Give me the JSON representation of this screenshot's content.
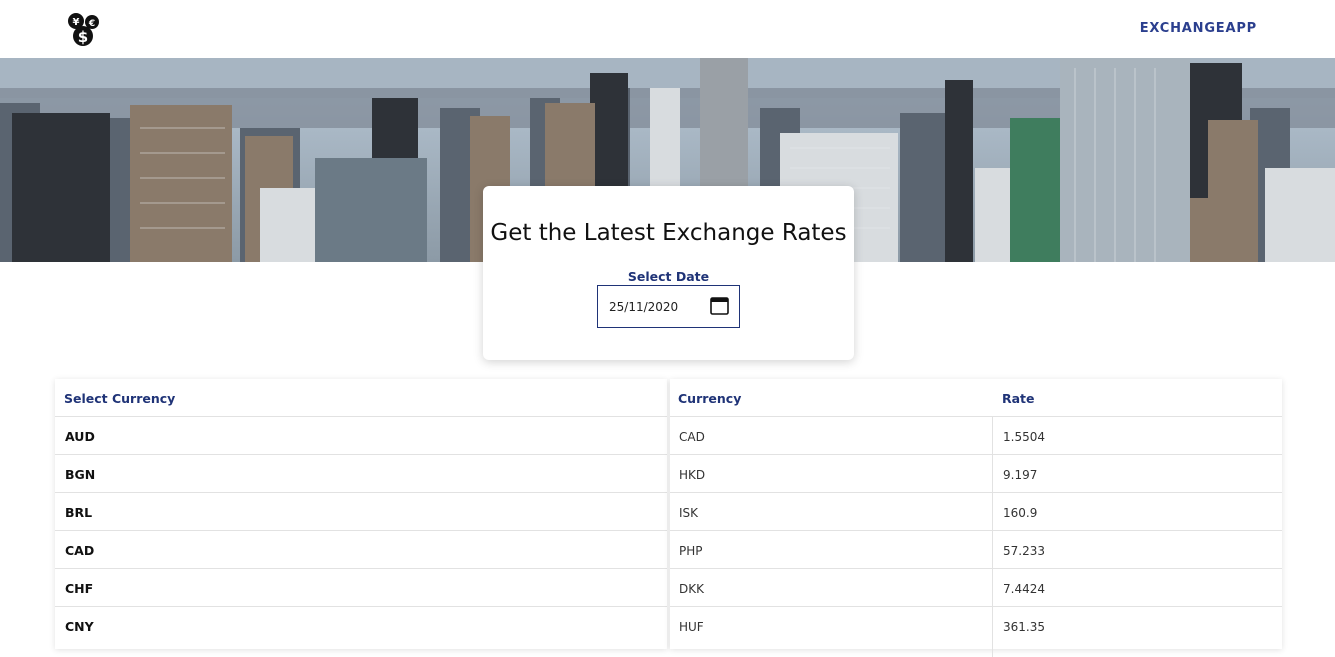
{
  "navbar": {
    "brand": "EXCHANGEAPP",
    "logo_icon": "currency-coins-icon"
  },
  "card": {
    "title": "Get the Latest Exchange Rates",
    "date_label": "Select Date",
    "date_value": "25/11/2020",
    "calendar_icon": "calendar-icon"
  },
  "currency_list": {
    "header": "Select Currency",
    "items": [
      "AUD",
      "BGN",
      "BRL",
      "CAD",
      "CHF",
      "CNY"
    ]
  },
  "rates_table": {
    "headers": [
      "Currency",
      "Rate"
    ],
    "rows": [
      [
        "CAD",
        "1.5504"
      ],
      [
        "HKD",
        "9.197"
      ],
      [
        "ISK",
        "160.9"
      ],
      [
        "PHP",
        "57.233"
      ],
      [
        "DKK",
        "7.4424"
      ],
      [
        "HUF",
        "361.35"
      ]
    ]
  }
}
